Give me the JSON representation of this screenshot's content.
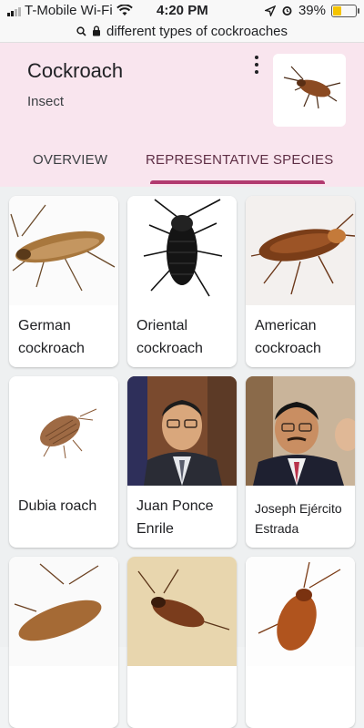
{
  "status_bar": {
    "carrier": "T-Mobile Wi-Fi",
    "time": "4:20 PM",
    "battery": "39%",
    "battery_level": 0.39
  },
  "url_bar": {
    "query": "different types of cockroaches"
  },
  "entity": {
    "title": "Cockroach",
    "subtitle": "Insect"
  },
  "tabs": [
    {
      "label": "OVERVIEW",
      "active": false
    },
    {
      "label": "REPRESENTATIVE SPECIES",
      "active": true
    }
  ],
  "species": [
    {
      "name": "German cockroach"
    },
    {
      "name": "Oriental cockroach"
    },
    {
      "name": "American cockroach"
    },
    {
      "name": "Dubia roach"
    },
    {
      "name": "Juan Ponce Enrile"
    },
    {
      "name": "Joseph Ejército Estrada"
    }
  ],
  "colors": {
    "header_bg": "#f9e5ee",
    "accent": "#b23a6f",
    "battery": "#f5c400"
  }
}
